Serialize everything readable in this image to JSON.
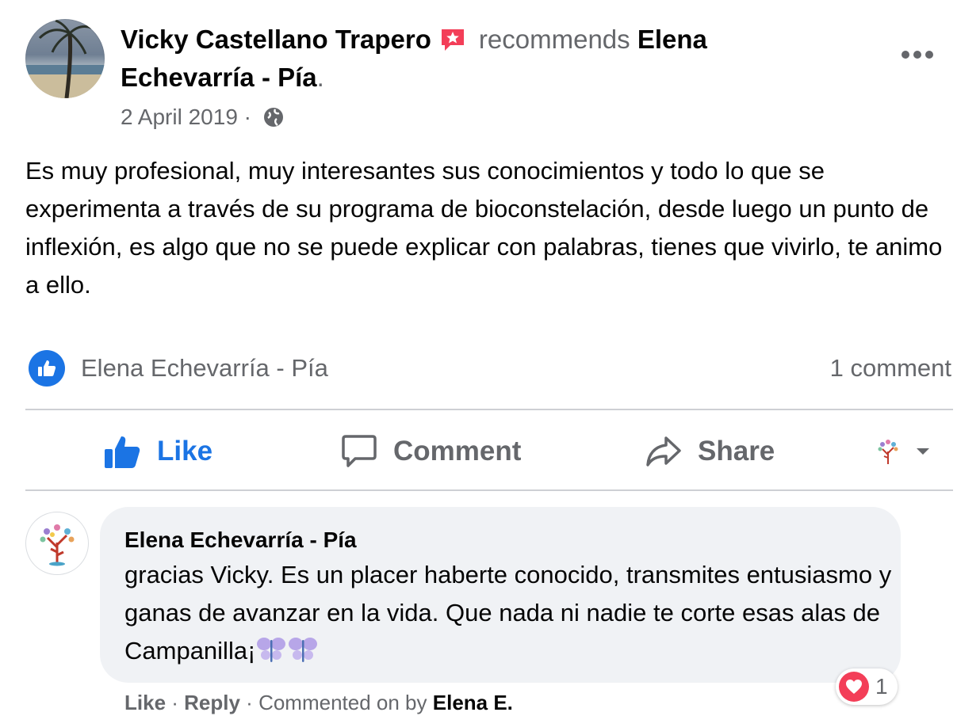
{
  "post": {
    "author": "Vicky Castellano Trapero",
    "verb": "recommends",
    "page_line1": "Elena",
    "page_line2": "Echevarría - Pía",
    "period": ".",
    "date": "2 April 2019",
    "separator": " · ",
    "privacy_icon": "globe-icon",
    "recommend_badge_color": "#f33e58",
    "text": "Es muy profesional, muy interesantes sus conocimientos y todo lo que se experimenta a través de su  programa de bioconstelación, desde luego un punto de inflexión, es algo que no se puede explicar con palabras, tienes que vivirlo, te animo a ello."
  },
  "reactions": {
    "icon": "like-icon",
    "names": "Elena Echevarría - Pía",
    "comment_count": "1 comment"
  },
  "actions": {
    "like": "Like",
    "comment": "Comment",
    "share": "Share",
    "accent_color": "#1b74e4"
  },
  "comment": {
    "author": "Elena Echevarría - Pía",
    "text": "gracias Vicky. Es un placer haberte conocido, transmites entusiasmo y ganas de avanzar en la vida. Que nada ni nadie te corte esas alas de Campanilla¡",
    "reaction_icon": "heart-icon",
    "reaction_count": "1",
    "footer_like": "Like",
    "footer_reply": "Reply",
    "footer_by": "Commented on by",
    "footer_name": "Elena E."
  }
}
